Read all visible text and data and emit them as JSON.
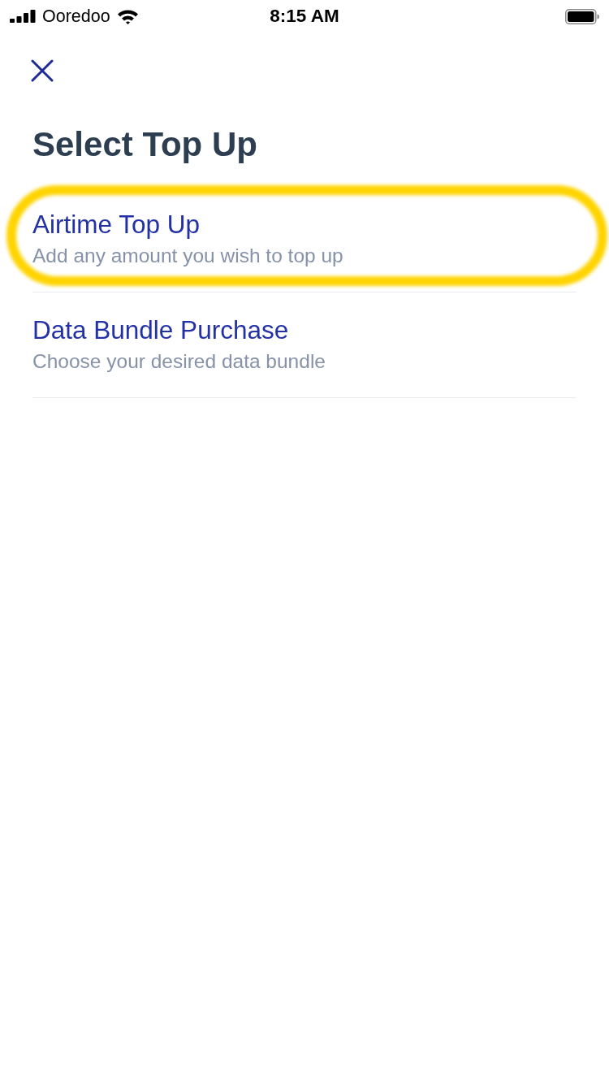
{
  "status_bar": {
    "carrier": "Ooredoo",
    "time": "8:15 AM"
  },
  "title": "Select Top Up",
  "items": [
    {
      "title": "Airtime Top Up",
      "subtitle": "Add any amount you wish to top up",
      "highlighted": true
    },
    {
      "title": "Data Bundle Purchase",
      "subtitle": "Choose your desired data bundle",
      "highlighted": false
    }
  ]
}
